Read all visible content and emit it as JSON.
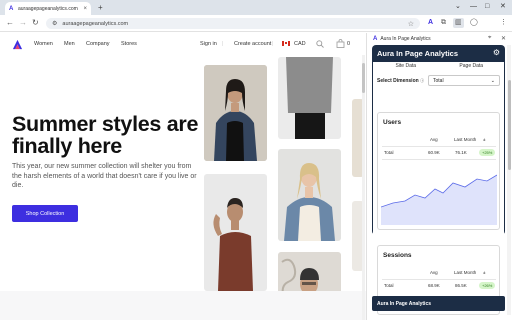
{
  "browser": {
    "tab_title": "auraagepageanalytics.com",
    "tab_favicon": "A",
    "tab_close": "×",
    "new_tab": "+",
    "url": "auraagepageanalytics.com",
    "window_controls": [
      "⌄",
      "—",
      "□",
      "✕"
    ]
  },
  "site": {
    "nav": {
      "women": "Women",
      "men": "Men",
      "company": "Company",
      "stores": "Stores",
      "sign_in": "Sign in",
      "create_account": "Create account",
      "currency": "CAD",
      "cart_count": "0"
    },
    "hero": {
      "title": "Summer styles are finally here",
      "text": "This year, our new summer collection will shelter you from the harsh elements of a world that doesn't care if you live or die.",
      "button": "Shop Collection"
    },
    "accent": "#3d2ee0"
  },
  "panel": {
    "header_title": "Aura In Page Analytics",
    "extension": {
      "title": "Aura In Page Analytics",
      "tabs": [
        "Site Data",
        "Page Data"
      ],
      "dimension_label": "Select Dimension",
      "dimension_value": "Total",
      "users": {
        "title": "Users",
        "col_avg": "Avg",
        "col_last_month": "Last Month",
        "col_delta": "±",
        "row_label": "Total",
        "avg": "60.9K",
        "last_month": "76.1K",
        "delta": "+25%"
      },
      "sessions": {
        "title": "Sessions",
        "col_avg": "Avg",
        "col_last_month": "Last Month",
        "col_delta": "±",
        "row_label": "Total",
        "avg": "68.9K",
        "last_month": "86.5K",
        "delta": "+26%"
      },
      "footer": "Aura In Page Analytics"
    },
    "card_color": "#1c2d45"
  }
}
